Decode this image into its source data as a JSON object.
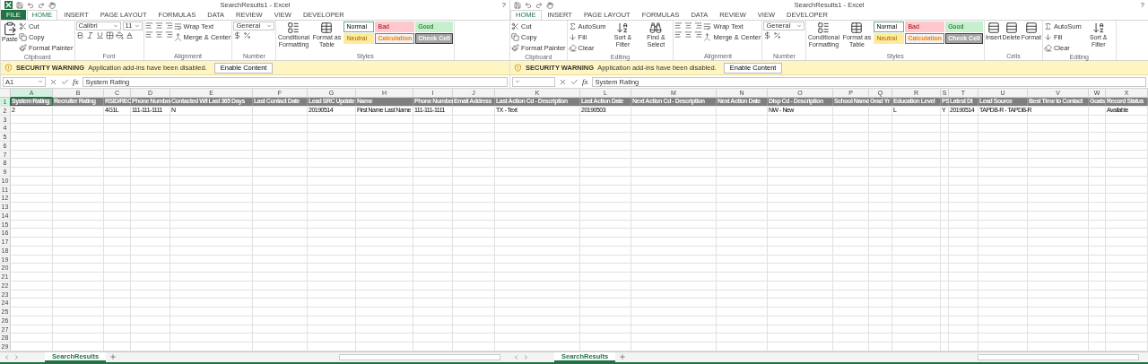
{
  "windows": [
    {
      "title": "SearchResults1 - Excel",
      "logo": true,
      "help": "?",
      "tabs": [
        {
          "label": "FILE",
          "kind": "file",
          "selected": false
        },
        {
          "label": "HOME",
          "kind": "tab",
          "selected": true
        },
        {
          "label": "INSERT",
          "kind": "tab",
          "selected": false
        },
        {
          "label": "PAGE LAYOUT",
          "kind": "tab",
          "selected": false
        },
        {
          "label": "FORMULAS",
          "kind": "tab",
          "selected": false
        },
        {
          "label": "DATA",
          "kind": "tab",
          "selected": false
        },
        {
          "label": "REVIEW",
          "kind": "tab",
          "selected": false
        },
        {
          "label": "VIEW",
          "kind": "tab",
          "selected": false
        },
        {
          "label": "DEVELOPER",
          "kind": "tab",
          "selected": false
        }
      ],
      "groups": [
        {
          "kind": "clipboard",
          "label": "Clipboard",
          "big": "Paste",
          "items": [
            "Cut",
            "Copy",
            "Format Painter"
          ]
        },
        {
          "kind": "font",
          "label": "Font",
          "font": "Calibri",
          "size": "11"
        },
        {
          "kind": "alignment",
          "label": "Alignment",
          "items": [
            "Wrap Text",
            "Merge & Center"
          ]
        },
        {
          "kind": "number",
          "label": "Number",
          "format": "General"
        },
        {
          "kind": "styles",
          "label": "Styles",
          "commands": [
            "Conditional Formatting",
            "Format as Table"
          ],
          "cells": [
            {
              "label": "Normal",
              "kind": "normal"
            },
            {
              "label": "Bad",
              "kind": "bad"
            },
            {
              "label": "Good",
              "kind": "good"
            },
            {
              "label": "Neutral",
              "kind": "neutral"
            },
            {
              "label": "Calculation",
              "kind": "calculation"
            },
            {
              "label": "Check Cell",
              "kind": "check"
            }
          ]
        }
      ],
      "security": {
        "title": "SECURITY WARNING",
        "message": "Application add-ins have been disabled.",
        "button": "Enable Content"
      },
      "name_box": "A1",
      "function_label": "fx",
      "formula": "System Rating",
      "sheet_tab": {
        "label": "SearchResults",
        "selected": true
      }
    },
    {
      "title": "SearchResults1 - Excel",
      "help": "?",
      "tabs": [
        {
          "label": "HOME",
          "kind": "tab",
          "selected": true
        },
        {
          "label": "INSERT",
          "kind": "tab",
          "selected": false
        },
        {
          "label": "PAGE LAYOUT",
          "kind": "tab",
          "selected": false
        },
        {
          "label": "FORMULAS",
          "kind": "tab",
          "selected": false
        },
        {
          "label": "DATA",
          "kind": "tab",
          "selected": false
        },
        {
          "label": "REVIEW",
          "kind": "tab",
          "selected": false
        },
        {
          "label": "VIEW",
          "kind": "tab",
          "selected": false
        },
        {
          "label": "DEVELOPER",
          "kind": "tab",
          "selected": false
        }
      ],
      "groups": [
        {
          "kind": "clipboard",
          "label": "Clipboard",
          "items": [
            "Cut",
            "Copy",
            "Format Painter"
          ]
        },
        {
          "kind": "editing",
          "label": "Editing",
          "items": [
            {
              "label": "AutoSum",
              "kind": "small"
            },
            {
              "label": "Fill",
              "kind": "small"
            },
            {
              "label": "Clear",
              "kind": "small"
            },
            {
              "label": "Sort & Filter",
              "kind": "big"
            },
            {
              "label": "Find & Select",
              "kind": "big"
            }
          ]
        },
        {
          "kind": "alignment",
          "label": "Alignment",
          "items": [
            "Wrap Text",
            "Merge & Center"
          ]
        },
        {
          "kind": "number",
          "label": "Number",
          "format": "General"
        },
        {
          "kind": "styles",
          "label": "Styles",
          "commands": [
            "Conditional Formatting",
            "Format as Table"
          ],
          "cells": [
            {
              "label": "Normal",
              "kind": "normal"
            },
            {
              "label": "Bad",
              "kind": "bad"
            },
            {
              "label": "Good",
              "kind": "good"
            },
            {
              "label": "Neutral",
              "kind": "neutral"
            },
            {
              "label": "Calculation",
              "kind": "calculation"
            },
            {
              "label": "Check Cell",
              "kind": "check"
            }
          ]
        },
        {
          "kind": "cells",
          "label": "Cells",
          "items": [
            "Insert",
            "Delete",
            "Format"
          ]
        },
        {
          "kind": "editing",
          "label": "Editing",
          "items": [
            {
              "label": "AutoSum",
              "kind": "small"
            },
            {
              "label": "Fill",
              "kind": "small"
            },
            {
              "label": "Clear",
              "kind": "small"
            },
            {
              "label": "Sort & Filter",
              "kind": "big"
            }
          ]
        }
      ],
      "security": {
        "title": "SECURITY WARNING",
        "message": "Application add-ins have been disabled.",
        "button": "Enable Content"
      },
      "function_label": "fx",
      "formula": "System Rating",
      "sheet_tab": {
        "label": "SearchResults",
        "selected": true
      }
    }
  ],
  "sheet": {
    "columns": [
      {
        "letter": "A",
        "selected": true
      },
      {
        "letter": "B",
        "selected": false
      },
      {
        "letter": "C",
        "selected": false
      },
      {
        "letter": "D",
        "selected": false
      },
      {
        "letter": "E",
        "selected": false
      },
      {
        "letter": "F",
        "selected": false
      },
      {
        "letter": "G",
        "selected": false
      },
      {
        "letter": "H",
        "selected": false
      },
      {
        "letter": "I",
        "selected": false
      },
      {
        "letter": "J",
        "selected": false
      },
      {
        "letter": "K",
        "selected": false
      },
      {
        "letter": "L",
        "selected": false
      },
      {
        "letter": "M",
        "selected": false
      },
      {
        "letter": "N",
        "selected": false
      },
      {
        "letter": "O",
        "selected": false
      },
      {
        "letter": "P",
        "selected": false
      },
      {
        "letter": "Q",
        "selected": false
      },
      {
        "letter": "R",
        "selected": false
      },
      {
        "letter": "S",
        "selected": false
      },
      {
        "letter": "T",
        "selected": false
      },
      {
        "letter": "U",
        "selected": false
      },
      {
        "letter": "V",
        "selected": false
      },
      {
        "letter": "W",
        "selected": false
      },
      {
        "letter": "X",
        "selected": false
      }
    ],
    "rows": [
      {
        "number": "1",
        "kind": "header",
        "selected": true,
        "cells": [
          "System Rating",
          "Recruiter Rating",
          "RSID/REC",
          "Phone Number",
          "Contacted W/I Last 365 Days",
          "Last Contact Date",
          "Lead SRC Update",
          "Name",
          "Phone Number",
          "Email Address",
          "Last Action Cd - Description",
          "Last Action Date",
          "Next Action Cd - Description",
          "Next Action Date",
          "Disp Cd - Description",
          "School Name",
          "Grad Yr",
          "Education Level",
          "PS",
          "Latest Dt",
          "Lead Source",
          "Best Time to Contact",
          "Goals",
          "Record Status"
        ]
      },
      {
        "number": "2",
        "selected": false,
        "cells": [
          "2",
          null,
          "4G1L",
          "111-111-1111",
          "N",
          null,
          "20190514",
          "First Name Last Name",
          "111-111-1111",
          null,
          "TX - Text",
          "20190503",
          null,
          null,
          "NW - New",
          null,
          null,
          "L",
          "Y",
          "20190514",
          "TAPDB-R - TAPDB-R",
          null,
          null,
          "Available"
        ]
      },
      {
        "number": "3",
        "selected": false
      },
      {
        "number": "4",
        "selected": false
      },
      {
        "number": "5",
        "selected": false
      },
      {
        "number": "6",
        "selected": false
      },
      {
        "number": "7",
        "selected": false
      },
      {
        "number": "8",
        "selected": false
      },
      {
        "number": "9",
        "selected": false
      },
      {
        "number": "10",
        "selected": false
      },
      {
        "number": "11",
        "selected": false
      },
      {
        "number": "12",
        "selected": false
      },
      {
        "number": "13",
        "selected": false
      },
      {
        "number": "14",
        "selected": false
      },
      {
        "number": "15",
        "selected": false
      },
      {
        "number": "16",
        "selected": false
      },
      {
        "number": "17",
        "selected": false
      },
      {
        "number": "18",
        "selected": false
      },
      {
        "number": "19",
        "selected": false
      },
      {
        "number": "20",
        "selected": false
      },
      {
        "number": "21",
        "selected": false
      },
      {
        "number": "22",
        "selected": false
      },
      {
        "number": "23",
        "selected": false
      },
      {
        "number": "24",
        "selected": false
      },
      {
        "number": "25",
        "selected": false
      },
      {
        "number": "26",
        "selected": false
      },
      {
        "number": "27",
        "selected": false
      },
      {
        "number": "28",
        "selected": false
      },
      {
        "number": "29",
        "selected": false
      }
    ]
  }
}
